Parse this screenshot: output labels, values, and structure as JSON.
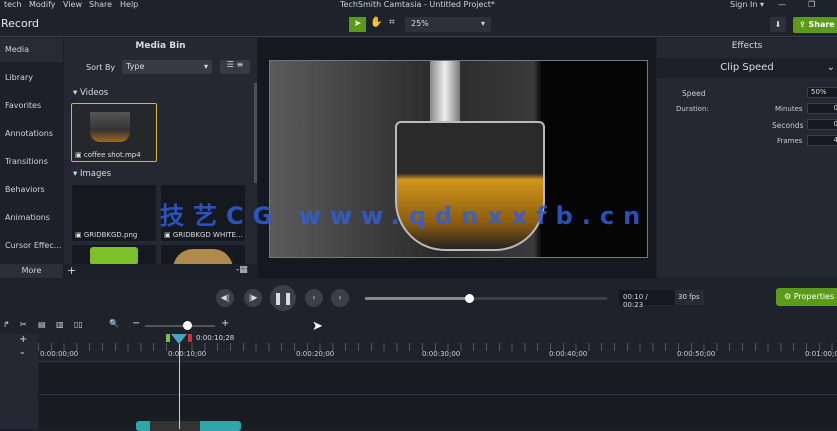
{
  "menu": [
    "tech",
    "Modify",
    "View",
    "Share",
    "Help"
  ],
  "window_title": "TechSmith Camtasia - Untitled Project*",
  "sign_in": "Sign In ▾",
  "record": "Record",
  "zoom_level": "25%",
  "share_label": "Share",
  "left_tabs": [
    "Media",
    "Library",
    "Favorites",
    "Annotations",
    "Transitions",
    "Behaviors",
    "Animations",
    "Cursor Effec..."
  ],
  "more_label": "More",
  "media_bin": {
    "title": "Media Bin",
    "sort_by": "Sort By",
    "sort_value": "Type",
    "videos_label": "Videos",
    "images_label": "Images",
    "video_items": [
      "coffee shot.mp4"
    ],
    "image_items": [
      "GRIDBKGD.png",
      "GRIDBKGD WHITE..."
    ]
  },
  "effects": {
    "title": "Effects",
    "section": "Clip Speed",
    "speed_label": "Speed",
    "speed_value": "50%",
    "duration_label": "Duration:",
    "minutes_label": "Minutes",
    "minutes_value": "0",
    "seconds_label": "Seconds",
    "seconds_value": "0",
    "frames_label": "Frames",
    "frames_value": "4"
  },
  "playback": {
    "time": "00:10 / 00:23",
    "fps": "30 fps",
    "progress": 0.43,
    "properties": "Properties"
  },
  "timeline": {
    "playhead_time": "0:00:10;28",
    "ticks": [
      "0:00:00;00",
      "0:00:10;00",
      "0:00:20;00",
      "0:00:30;00",
      "0:00:40;00",
      "0:00:50;00",
      "0:01:00;00"
    ],
    "zoom_fraction": 0.6
  },
  "watermark": "技艺CG www.qdnxxfb.cn",
  "colors": {
    "accent_green": "#5c9a1c",
    "selection_gold": "#d8b24a",
    "playhead": "#4aa3c0"
  }
}
